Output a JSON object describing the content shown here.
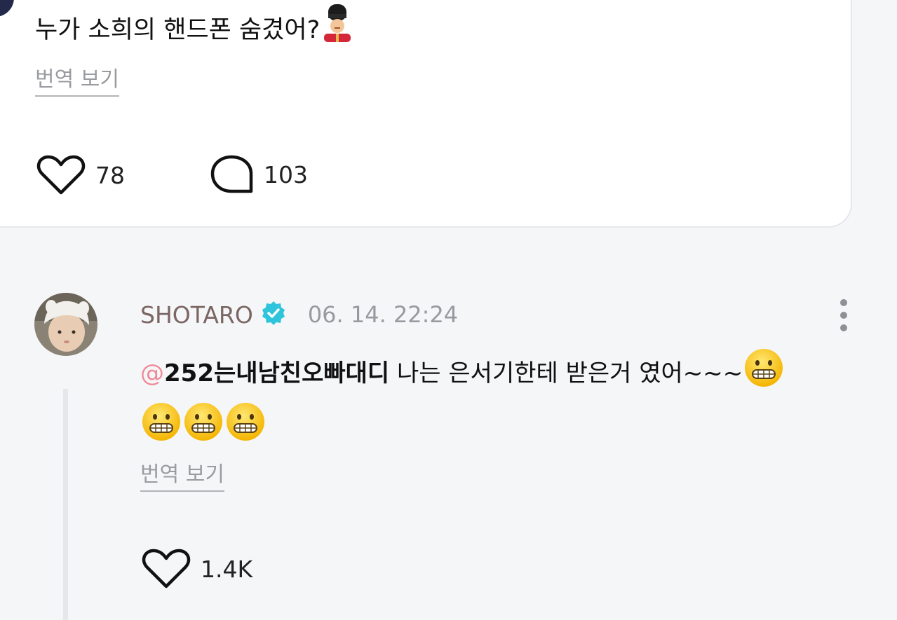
{
  "post": {
    "text": "누가 소희의 핸드폰 숨겼어?",
    "emoji": "guard-emoji",
    "translate": "번역 보기",
    "likes": "78",
    "comments": "103"
  },
  "comment": {
    "username": "SHOTARO",
    "verified": true,
    "date": "06. 14. 22:24",
    "mention_at": "@",
    "mention_tag": "252는내남친오빠대디",
    "text": " 나는 은서기한테 받은거 였어~~~",
    "emojis": [
      "grimacing-face",
      "grimacing-face",
      "grimacing-face",
      "grimacing-face"
    ],
    "translate": "번역 보기",
    "likes": "1.4K"
  },
  "colors": {
    "background": "#f5f6f8",
    "card": "#ffffff",
    "username": "#7c6664",
    "mention": "#f08a9a",
    "verified_badge": "#2ec4dc",
    "muted": "#999aa0"
  }
}
